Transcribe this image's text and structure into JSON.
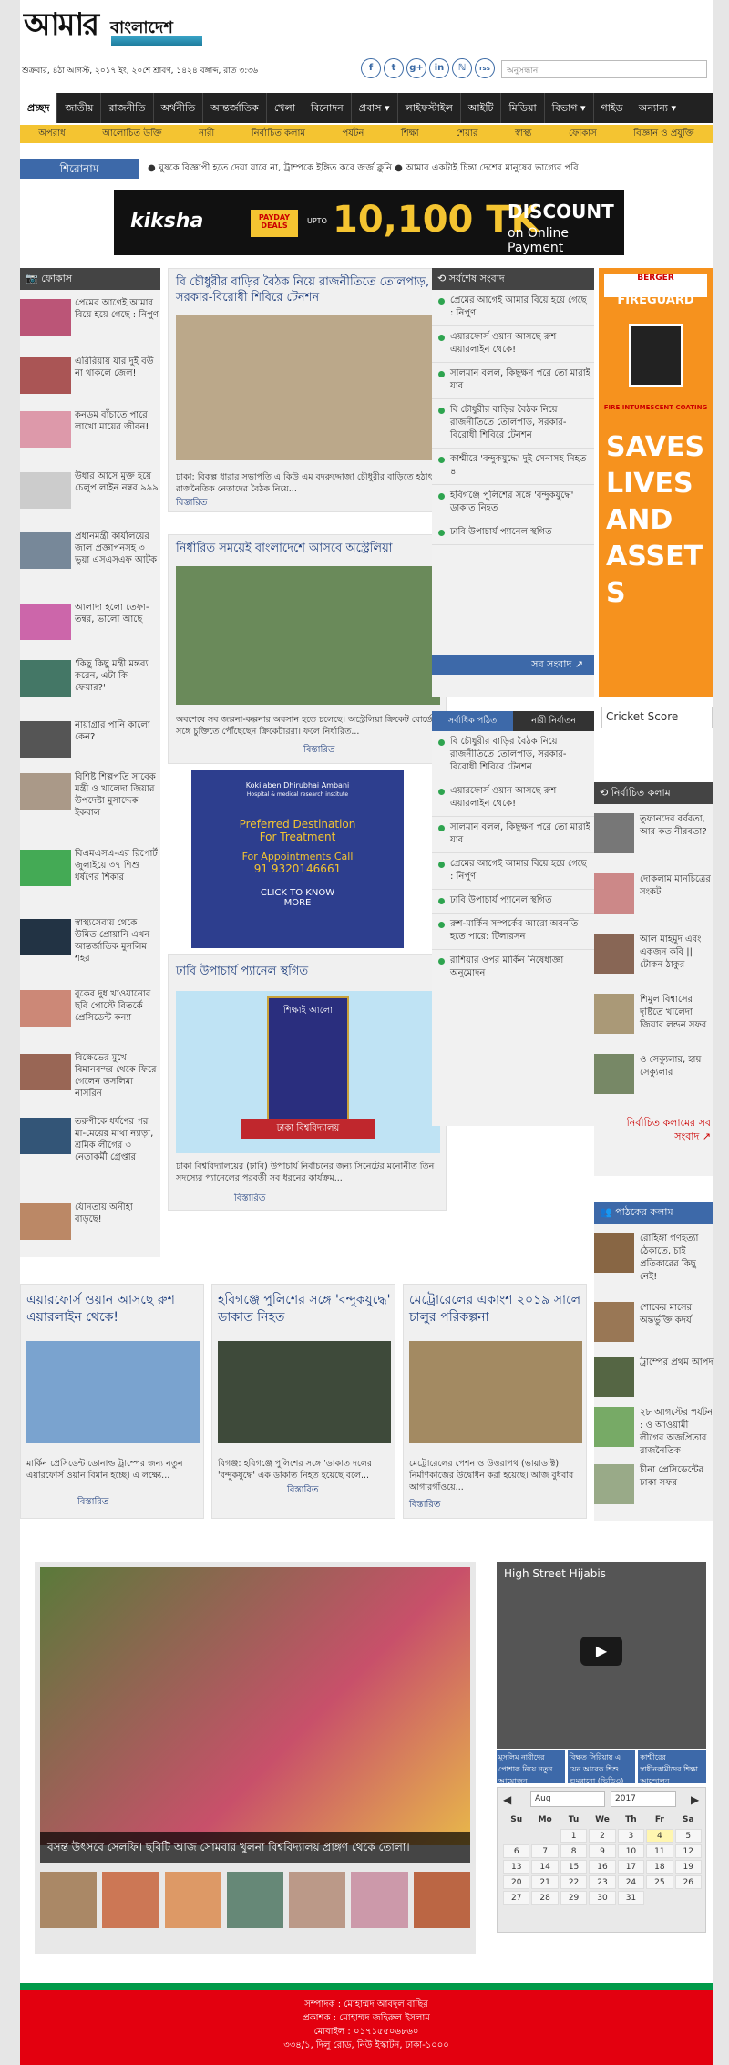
{
  "header": {
    "logo_main": "আমার",
    "logo_sub": "বাংলাদেশ",
    "date": "শুক্রবার, ৪ঠা আগস্ট, ২০১৭ ইং, ২০শে শ্রাবণ, ১৪২৪ বঙ্গাব্দ, রাত ৩:৩৬",
    "social": [
      "f",
      "t",
      "g+",
      "in",
      "ℕ",
      "rss"
    ],
    "search_placeholder": "অনুসন্ধান"
  },
  "nav": {
    "main": [
      "প্রচ্ছদ",
      "জাতীয়",
      "রাজনীতি",
      "অর্থনীতি",
      "আন্তর্জাতিক",
      "খেলা",
      "বিনোদন",
      "প্রবাস ▾",
      "লাইফস্টাইল",
      "আইটি",
      "মিডিয়া",
      "বিভাগ ▾",
      "গাইড",
      "অন্যান্য ▾"
    ],
    "sub": [
      "অপরাধ",
      "আলোচিত উক্তি",
      "নারী",
      "নির্বাচিত কলাম",
      "পর্যটন",
      "শিক্ষা",
      "শেয়ার",
      "স্বাস্থ্য",
      "ফোকাস",
      "বিজ্ঞান ও প্রযুক্তি"
    ]
  },
  "headline": {
    "label": "শিরোনাম",
    "text": "● ঘুষকে বিজ্ঞাপী হতে দেয়া যাবে না, ট্রাম্পকে ইঙ্গিত করে জর্জ ক্লুনি  ● আমার একটাই চিন্তা দেশের মানুষের ভাগ্যের পরি"
  },
  "ad_top": {
    "brand": "kiksha",
    "payday": "PAYDAY DEALS",
    "upto": "UPTO",
    "amount": "10,100 TK",
    "discount": "DISCOUNT",
    "online": "on Online Payment"
  },
  "focus": {
    "title": "ফোকাস",
    "items": [
      "প্রেমের আগেই আমার বিয়ে হয়ে গেছে : নিপুণ",
      "এরিরিয়ায় যার দুই বউ না থাকলে জেল!",
      "কনডম বাঁচাতে পারে লাখো মায়ের জীবন!",
      "উধার আসে মুক্ত হয়ে চেলুপ লাইন নম্বর ৯৯৯",
      "প্রধানমন্ত্রী কার্যালয়ের জাল প্রজ্ঞাপনসহ ৩ ভুয়া এসএসএফ আটক",
      "আলাদা হলো তেফা-তন্বর, ভালো আছে",
      "'কিছু কিছু মন্ত্রী মন্তব্য করেন, এটা কি ফেয়ার?'",
      "নায়াগ্রার পানি কালো কেন?",
      "বিশিষ্ট শিল্পপতি সাবেক মন্ত্রী ও খালেদা জিয়ার উপদেষ্টা মুসাদ্দেক ইকবাল",
      "বিএমএসএ-এর রিপোর্ট জুলাইয়ে ৩৭ শিশু ধর্ষণের শিকার",
      "স্বাস্থ্যসেবায় থেকে উমিত প্রোয়ানি এখন আন্তর্জাতিক মুসলিম শহর",
      "বুকের দুধ খাওয়ানোর ছবি পোস্টে বিতর্কে প্রেসিডেন্ট কন্যা",
      "বিক্ষেভের মুখে বিমানবন্দর থেকে ফিরে গেলেন তসলিমা নাসরিন",
      "তরুণীকে ধর্ষণের পর মা-মেয়ের মাথা ন্যাড়া, শ্রমিক লীগের ৩ নেতাকর্মী গ্রেপ্তার",
      "যৌনতায় অনীহা বাড়ছে!"
    ]
  },
  "center": {
    "story1": {
      "title": "বি চৌধুরীর বাড়ির বৈঠক নিয়ে রাজনীতিতে তোলপাড়, সরকার-বিরোধী শিবিরে টেনশন",
      "desc": "ঢাকা: বিকল্প ধারার সভাপতি এ কিউ এম বদরুদ্দোজা চৌধুরীর বাড়িতে হঠাৎ রাজনৈতিক নেতাদের বৈঠক নিয়ে...",
      "more": "বিস্তারিত"
    },
    "story2": {
      "title": "নির্ধারিত সময়েই বাংলাদেশে আসবে অস্ট্রেলিয়া",
      "desc": "অবশেষে সব জল্পনা-কল্পনার অবসান হতে চলেছে। অস্ট্রেলিয়া ক্রিকেট বোর্ডের সঙ্গে চুক্তিতে পৌঁছেছেন ক্রিকেটাররা। ফলে নির্ধারিত...",
      "more": "বিস্তারিত"
    },
    "ad_mid": {
      "hospital": "Kokilaben Dhirubhai Ambani",
      "sub": "Hospital & medical research institute",
      "tag1": "Preferred Destination",
      "tag2": "For Treatment",
      "call": "For Appointments Call",
      "phone": "91 9320146661",
      "cta": "CLICK TO KNOW MORE"
    },
    "story3": {
      "title": "ঢাবি উপাচার্য প্যানেল স্থগিত",
      "desc": "ঢাকা বিশ্ববিদ্যালয়ের (ঢাবি) উপাচার্য নির্বাচনের জন্য সিনেটের মনোনীত তিন সদস্যের প্যানেলের পরবর্তী সব ধরনের কার্যক্রম...",
      "more": "বিস্তারিত",
      "logo_top": "শিক্ষাই আলো",
      "logo_bottom": "ঢাকা বিশ্ববিদ্যালয়"
    }
  },
  "latest": {
    "title": "সর্বশেষ সংবাদ",
    "items": [
      "প্রেমের আগেই আমার বিয়ে হয়ে গেছে : নিপুণ",
      "এয়ারফোর্স ওয়ান আসছে রুশ এয়ারলাইন থেকে!",
      "সালমান বলল, কিছুক্ষণ পরে তো মারাই যাব",
      "বি চৌধুরীর বাড়ির বৈঠক নিয়ে রাজনীতিতে তোলপাড়, সরকার-বিরোধী শিবিরে টেনশন",
      "কাশ্মীরে 'বন্দুকযুদ্ধে' দুই সেনাসহ নিহত ৪",
      "হবিগঞ্জে পুলিশের সঙ্গে 'বন্দুকযুদ্ধে' ডাকাত নিহত",
      "ঢাবি উপাচার্য প্যানেল স্থগিত"
    ],
    "more": "সব সংবাদ ↗"
  },
  "tabs": {
    "tab1": "সর্বাধিক পঠিত",
    "tab2": "নারী নির্যাতন",
    "items": [
      "বি চৌধুরীর বাড়ির বৈঠক নিয়ে রাজনীতিতে তোলপাড়, সরকার-বিরোধী শিবিরে টেনশন",
      "এয়ারফোর্স ওয়ান আসছে রুশ এয়ারলাইন থেকে!",
      "সালমান বলল, কিছুক্ষণ পরে তো মারাই যাব",
      "প্রেমের আগেই আমার বিয়ে হয়ে গেছে : নিপুণ",
      "ঢাবি উপাচার্য প্যানেল স্থগিত",
      "রুশ-মার্কিন সম্পর্কের আরো অবনতি হতে পারে: টিলারসন",
      "রাশিয়ার ওপর মার্কিন নিষেধাজ্ঞা অনুমোদন"
    ]
  },
  "right_ad": {
    "brand": "BERGER",
    "product": "FIREGUARD",
    "coating": "FIRE INTUMESCENT COATING",
    "saves": "SAVES LIVES AND ASSETS"
  },
  "cricket": "Cricket Score",
  "columns": {
    "title": "নির্বাচিত কলাম",
    "items": [
      "তুফানদের বর্বরতা, আর কত নীরবতা?",
      "দোকলাম মানচিত্রের সংকট",
      "আল মাহমুদ এবং একজন কবি || টোকন ঠাকুর",
      "শিমুল বিশ্বাসের দৃষ্টিতে খালেদা জিয়ার লন্ডন সফর",
      "ও সেক্যুলার, হায় সেক্যুলার"
    ],
    "more": "নির্বাচিত কলামের সব সংবাদ ↗"
  },
  "readers": {
    "title": "পাঠকের কলাম",
    "items": [
      "রোহিঙ্গা গণহত্যা ঠেকাতে, চাই প্রতিকারের কিছু নেই!",
      "শোকের মাসের অন্তর্ভুক্তি কদর্য",
      "ট্রাম্পের প্রথম আপদ",
      "২৮ আগস্টের পর্যটন : ও আওয়ামী লীগের অজপ্রিতার রাজনৈতিক",
      "চীনা প্রেসিডেন্টের ঢাকা সফর"
    ]
  },
  "bottom": [
    {
      "title": "এয়ারফোর্স ওয়ান আসছে রুশ এয়ারলাইন থেকে!",
      "desc": "মার্কিন প্রেসিডেন্ট ডোনাল্ড ট্রাম্পের জন্য নতুন এয়ারফোর্স ওয়ান বিমান হচ্ছে। এ লক্ষ্যে...",
      "more": "বিস্তারিত"
    },
    {
      "title": "হবিগঞ্জে পুলিশের সঙ্গে 'বন্দুকযুদ্ধে' ডাকাত নিহত",
      "desc": "বিগঞ্জ: হবিগঞ্জে পুলিশের সঙ্গে 'ডাকাত দলের 'বন্দুকযুদ্ধে' এক ডাকাত নিহত হয়েছে বলে...",
      "more": "বিস্তারিত"
    },
    {
      "title": "মেট্রোরেলের একাংশ ২০১৯ সালে চালুর পরিকল্পনা",
      "desc": "মেট্রোরেলের পেশন ও উত্তরাপথ (ভায়াডাক্ট) নির্মাণকাজের উদ্বোধন করা হয়েছে। আজ বুধবার আগারগাঁওয়ে...",
      "more": "বিস্তারিত"
    }
  ],
  "gallery": {
    "caption": "বসন্ত উৎসবে সেলফি। ছবিটি আজ সোমবার খুলনা বিশ্ববিদ্যালয় প্রাঙ্গণ থেকে তোলা।"
  },
  "video": {
    "title": "High Street Hijabis",
    "links": [
      "মুসলিম নারীদের পোশাক নিয়ে নতুন আয়োজন",
      "বিক্ষত সিরিয়ায় এ যেন আরেক শিশু গুমরানো (ভিডিও)",
      "কাশ্মীরের স্বাধীনকামীদের শিক্ষা আন্দোলন"
    ]
  },
  "calendar": {
    "month": "Aug",
    "year": "2017",
    "days": [
      "Su",
      "Mo",
      "Tu",
      "We",
      "Th",
      "Fr",
      "Sa"
    ],
    "dates": [
      "",
      "",
      "1",
      "2",
      "3",
      "4",
      "5",
      "6",
      "7",
      "8",
      "9",
      "10",
      "11",
      "12",
      "13",
      "14",
      "15",
      "16",
      "17",
      "18",
      "19",
      "20",
      "21",
      "22",
      "23",
      "24",
      "25",
      "26",
      "27",
      "28",
      "29",
      "30",
      "31",
      "",
      ""
    ]
  },
  "footer": {
    "line1": "সম্পাদক : মোহাম্মদ আবদুল বাছির",
    "line2": "প্রকাশক : মোহাম্মদ জহিরুল ইসলাম",
    "line3": "মোবাইল : ০১৭১৫৫০৬৮৬০",
    "line4": "৩৩৪/১, দিলু রোড, নিউ ইস্কাটন, ঢাকা-১০০০"
  },
  "colors": {
    "nav": "#222222",
    "subnav": "#f4c431",
    "accent": "#3d69a9",
    "footer": "#e3000f",
    "footer_border": "#009a49"
  }
}
